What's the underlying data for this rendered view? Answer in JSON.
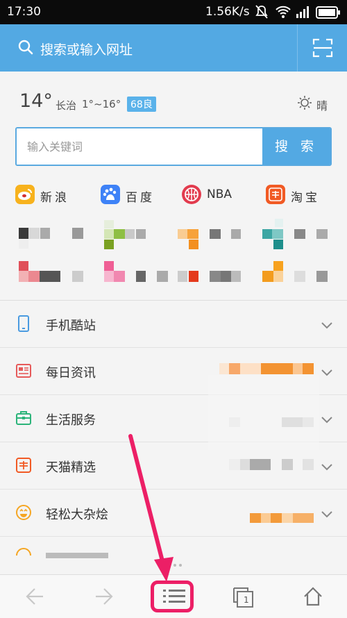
{
  "status_bar": {
    "time": "17:30",
    "speed": "1.56K/s"
  },
  "search": {
    "placeholder": "搜索或输入网址"
  },
  "weather": {
    "temperature": "14°",
    "city": "长治",
    "range": "1°~16°",
    "aqi": "68良",
    "condition": "晴"
  },
  "keyword_search": {
    "placeholder": "输入关键词",
    "button": "搜 索"
  },
  "quick_sites": [
    {
      "name": "新浪",
      "icon": "sina-weibo-icon",
      "color": "#f7b21d"
    },
    {
      "name": "百度",
      "icon": "baidu-icon",
      "color": "#3e82f7"
    },
    {
      "name": "NBA",
      "icon": "nba-icon",
      "color": "#e23b4e"
    },
    {
      "name": "淘宝",
      "icon": "taobao-icon",
      "color": "#f15a24"
    }
  ],
  "categories": [
    {
      "label": "手机酷站",
      "icon": "phone-icon",
      "color": "#4a9be0"
    },
    {
      "label": "每日资讯",
      "icon": "news-icon",
      "color": "#e65a5a"
    },
    {
      "label": "生活服务",
      "icon": "briefcase-icon",
      "color": "#2cb47a"
    },
    {
      "label": "天猫精选",
      "icon": "taobao-icon",
      "color": "#f15a24"
    },
    {
      "label": "轻松大杂烩",
      "icon": "smiley-icon",
      "color": "#f5a623"
    }
  ],
  "bottom_nav": {
    "tab_count": "1"
  },
  "accent": "#53a9e3"
}
